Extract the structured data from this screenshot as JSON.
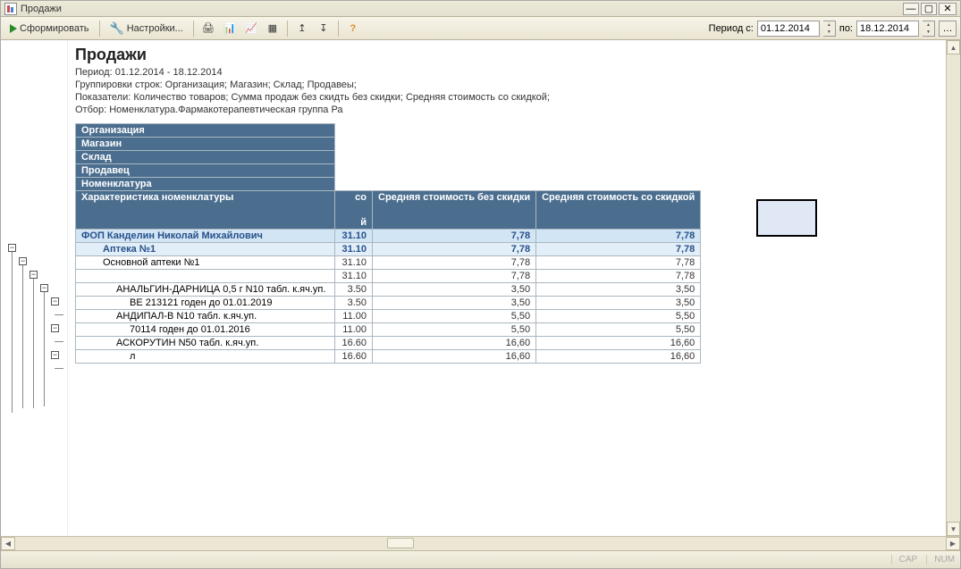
{
  "window": {
    "title": "Продажи"
  },
  "toolbar": {
    "form_label": "Сформировать",
    "settings_label": "Настройки...",
    "period_label": "Период с:",
    "date_from": "01.12.2014",
    "date_to_label": "по:",
    "date_to": "18.12.2014"
  },
  "report": {
    "title": "Продажи",
    "period_line": "Период: 01.12.2014 - 18.12.2014",
    "grouping_line": "Группировки строк: Организация; Магазин; Склад; Продавеы;",
    "indicators_line": "Показатели: Количество товаров; Сумма продаж без скидть без скидки; Средняя стоимость со скидкой;",
    "filter_line": "Отбор: Номенклатура.Фармакотерапевтическая группа Ра"
  },
  "group_headers": {
    "r1": "Организация",
    "r2": "Магазин",
    "r3": "Склад",
    "r4": "Продавец",
    "r5": "Номенклатура",
    "r6": "Характеристика номенклатуры",
    "col1_frag": "со",
    "col1_frag2": "й",
    "col2": "Средняя стоимость без скидки",
    "col3": "Средняя стоимость со скидкой"
  },
  "rows": [
    {
      "label": "ФОП Канделин Николай Михайлович",
      "c1": "31.10",
      "c2": "7,78",
      "c3": "7,78",
      "cls": "row-org",
      "indent": ""
    },
    {
      "label": "Аптека №1",
      "c1": "31.10",
      "c2": "7,78",
      "c3": "7,78",
      "cls": "row-store",
      "indent": "indent1"
    },
    {
      "label": "Основной аптеки №1",
      "c1": "31.10",
      "c2": "7,78",
      "c3": "7,78",
      "cls": "row-plain",
      "indent": "indent1"
    },
    {
      "label": "",
      "c1": "31.10",
      "c2": "7,78",
      "c3": "7,78",
      "cls": "row-plain",
      "indent": ""
    },
    {
      "label": "АНАЛЬГИН-ДАРНИЦА 0,5 г N10 табл. к.яч.уп.",
      "c1": "3.50",
      "c2": "3,50",
      "c3": "3,50",
      "cls": "row-plain",
      "indent": "indent2"
    },
    {
      "label": "ВЕ 213121 годен до 01.01.2019",
      "c1": "3.50",
      "c2": "3,50",
      "c3": "3,50",
      "cls": "row-plain",
      "indent": "indent3"
    },
    {
      "label": "АНДИПАЛ-В N10 табл. к.яч.уп.",
      "c1": "11.00",
      "c2": "5,50",
      "c3": "5,50",
      "cls": "row-plain",
      "indent": "indent2"
    },
    {
      "label": "70114 годен до 01.01.2016",
      "c1": "11.00",
      "c2": "5,50",
      "c3": "5,50",
      "cls": "row-plain",
      "indent": "indent3"
    },
    {
      "label": "АСКОРУТИН N50 табл. к.яч.уп.",
      "c1": "16.60",
      "c2": "16,60",
      "c3": "16,60",
      "cls": "row-plain",
      "indent": "indent2"
    },
    {
      "label": "л",
      "c1": "16.60",
      "c2": "16,60",
      "c3": "16,60",
      "cls": "row-plain",
      "indent": "indent3"
    }
  ],
  "status": {
    "cap": "CAP",
    "num": "NUM"
  }
}
